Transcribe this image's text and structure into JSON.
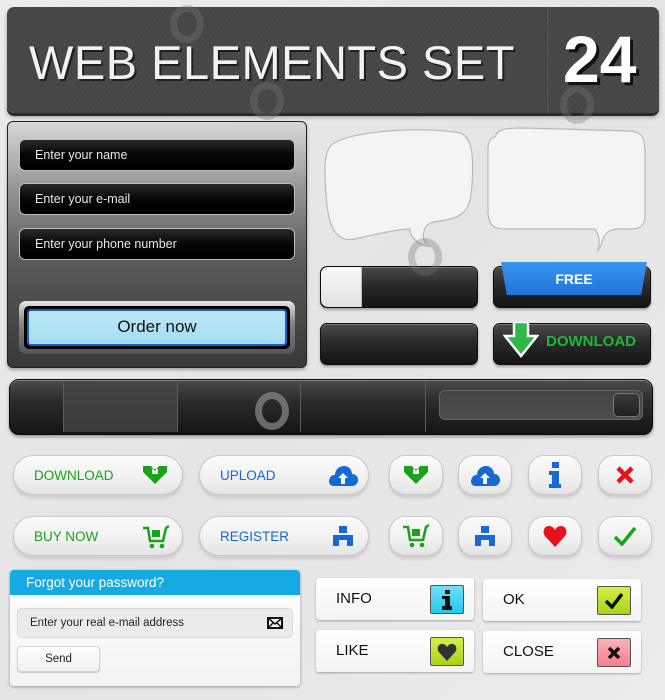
{
  "header": {
    "title": "WEB ELEMENTS SET",
    "number": "24"
  },
  "order_form": {
    "fields": [
      {
        "placeholder": "Enter your name"
      },
      {
        "placeholder": "Enter your e-mail"
      },
      {
        "placeholder": "Enter your phone number"
      }
    ],
    "submit_label": "Order now"
  },
  "dark_buttons": {
    "free_label": "FREE",
    "download_label": "DOWNLOAD"
  },
  "pill_buttons": [
    {
      "label": "DOWNLOAD",
      "icon": "download-icon",
      "color": "#1aa31a"
    },
    {
      "label": "UPLOAD",
      "icon": "cloud-upload-icon",
      "color": "#1668d4"
    },
    {
      "label": "BUY NOW",
      "icon": "cart-icon",
      "color": "#1aa31a"
    },
    {
      "label": "REGISTER",
      "icon": "user-icon",
      "color": "#1668d4"
    }
  ],
  "icon_buttons": [
    {
      "icon": "download-icon",
      "color": "#1aa31a"
    },
    {
      "icon": "cloud-upload-icon",
      "color": "#1668d4"
    },
    {
      "icon": "info-icon",
      "color": "#1668d4"
    },
    {
      "icon": "close-icon",
      "color": "#e8101a"
    },
    {
      "icon": "cart-icon",
      "color": "#1aa31a"
    },
    {
      "icon": "user-icon",
      "color": "#1668d4"
    },
    {
      "icon": "heart-icon",
      "color": "#e8101a"
    },
    {
      "icon": "checkmark-icon",
      "color": "#1aa31a"
    }
  ],
  "forgot_password": {
    "title": "Forgot your password?",
    "email_placeholder": "Enter your real e-mail address",
    "send_label": "Send",
    "accent": "#15aae4"
  },
  "flat_buttons": [
    {
      "label": "INFO",
      "icon": "info-icon",
      "icon_bg": "#22c9ef"
    },
    {
      "label": "OK",
      "icon": "checkmark-icon",
      "icon_bg": "#a8d41a"
    },
    {
      "label": "LIKE",
      "icon": "heart-icon",
      "icon_bg": "#a8d41a"
    },
    {
      "label": "CLOSE",
      "icon": "close-icon",
      "icon_bg": "#f4808c"
    }
  ]
}
